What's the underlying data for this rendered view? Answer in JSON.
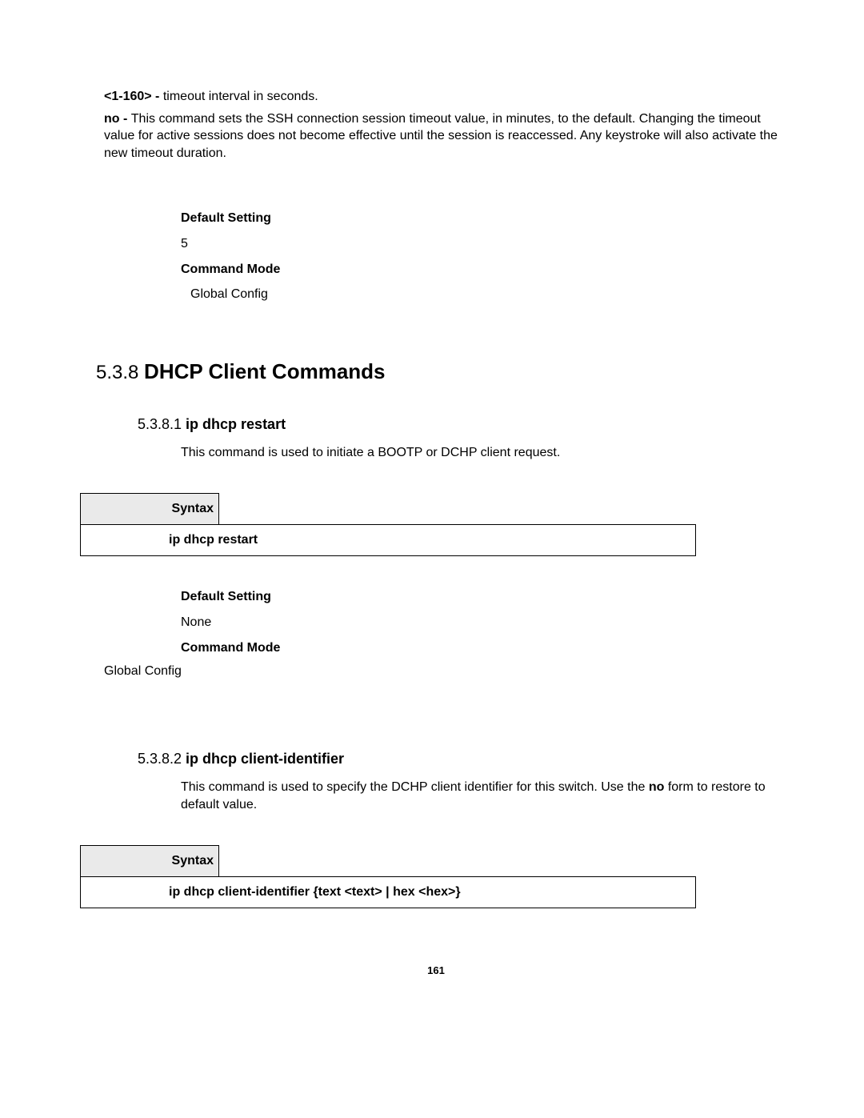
{
  "top": {
    "param_label": "<1-160> -",
    "param_desc": " timeout interval in seconds.",
    "no_label": "no - ",
    "no_desc": "This command sets the SSH connection session timeout value, in minutes, to the default. Changing the timeout value for active sessions does not become effective until the session is reaccessed. Any keystroke will also activate the new timeout duration."
  },
  "settings1": {
    "default_label": "Default Setting",
    "default_value": "5",
    "mode_label": "Command Mode",
    "mode_value": "Global Config"
  },
  "section": {
    "num": "5.3.8 ",
    "title": "DHCP Client Commands"
  },
  "sub1": {
    "num": "5.3.8.1 ",
    "title": "ip dhcp restart",
    "desc": "This command is used to initiate a BOOTP or DCHP client request.",
    "syntax_label": "Syntax",
    "syntax_cmd": "ip dhcp restart",
    "default_label": "Default Setting",
    "default_value": "None",
    "mode_label": "Command Mode",
    "mode_value": "Global Config"
  },
  "sub2": {
    "num": "5.3.8.2 ",
    "title": "ip dhcp client-identifier",
    "desc_pre": "This command is used to specify the DCHP client identifier for this switch. Use the ",
    "desc_bold": "no",
    "desc_post": " form to restore to default value.",
    "syntax_label": "Syntax",
    "syntax_cmd": "ip dhcp client-identifier {text <text> | hex <hex>}"
  },
  "page_number": "161"
}
